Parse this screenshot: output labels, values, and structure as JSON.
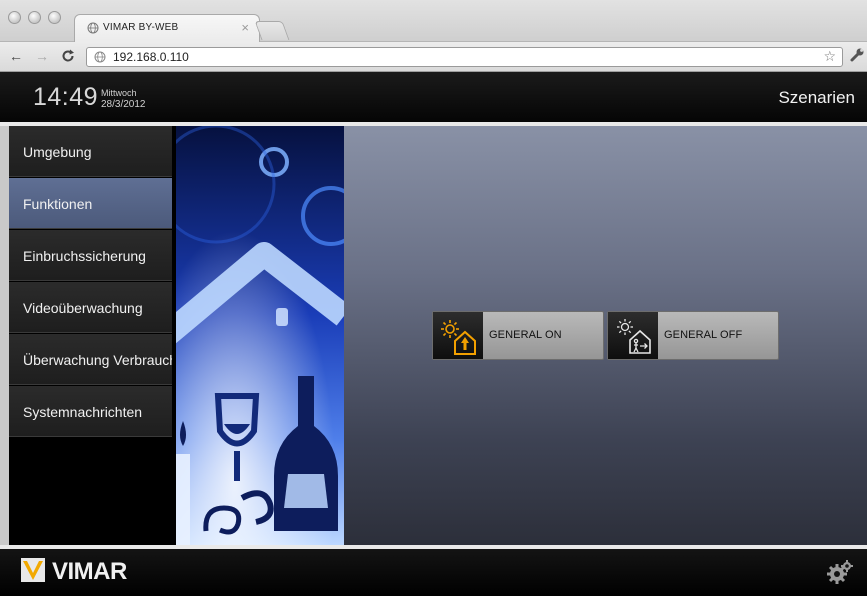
{
  "browser": {
    "tab_title": "VIMAR BY-WEB",
    "tab_close": "×",
    "url": "192.168.0.110",
    "icons": {
      "back": "back-arrow-icon",
      "forward": "forward-arrow-icon",
      "reload": "reload-icon",
      "bookmark": "star-icon",
      "menu": "wrench-icon"
    }
  },
  "header": {
    "time": "14:49",
    "weekday": "Mittwoch",
    "date": "28/3/2012",
    "section_title": "Szenarien"
  },
  "sidebar": {
    "items": [
      {
        "label": "Umgebung",
        "active": false
      },
      {
        "label": "Funktionen",
        "active": true
      },
      {
        "label": "Einbruchssicherung",
        "active": false
      },
      {
        "label": "Videoüberwachung",
        "active": false
      },
      {
        "label": "Überwachung Verbrauch",
        "active": false
      },
      {
        "label": "Systemnachrichten",
        "active": false
      }
    ]
  },
  "scenes": [
    {
      "label": "GENERAL ON",
      "icon": "house-sun-on-icon"
    },
    {
      "label": "GENERAL OFF",
      "icon": "house-sun-off-icon"
    }
  ],
  "footer": {
    "brand": "VIMAR",
    "settings_icon": "gears-icon"
  },
  "colors": {
    "active_menu": "#5a6a8f",
    "accent_orange": "#f3a000"
  }
}
